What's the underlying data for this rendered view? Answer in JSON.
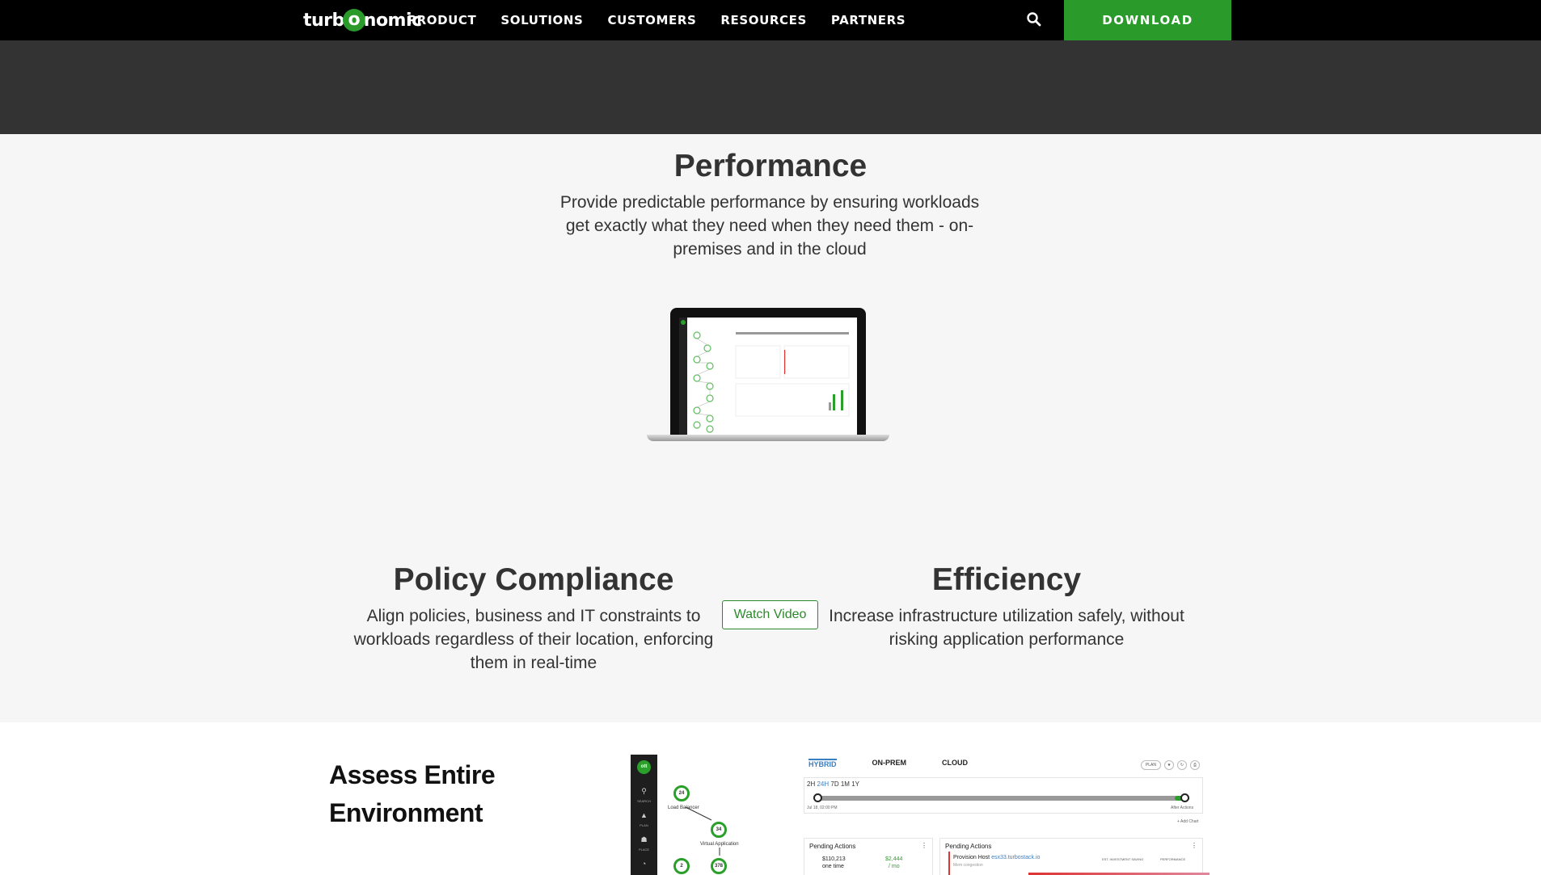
{
  "nav": {
    "logo_left": "turb",
    "logo_o": "o",
    "logo_right": "nomic",
    "links": [
      "PRODUCT",
      "SOLUTIONS",
      "CUSTOMERS",
      "RESOURCES",
      "PARTNERS"
    ],
    "search_icon": "search-icon",
    "download_label": "DOWNLOAD",
    "download_color": "#2a9a2a"
  },
  "features": {
    "performance": {
      "title": "Performance",
      "description": "Provide predictable performance by ensuring workloads get exactly what they need when they need them - on-premises and in the cloud"
    },
    "watch_video_label": "Watch Video",
    "policy": {
      "title": "Policy Compliance",
      "description": "Align policies, business and IT constraints to workloads regardless of their location, enforcing them in real-time"
    },
    "efficiency": {
      "title": "Efficiency",
      "description": "Increase infrastructure utilization safely, without risking application performance"
    }
  },
  "assess": {
    "title": "Assess Entire Environment",
    "dashboard": {
      "logo_text": "ott",
      "sidebar": [
        "SEARCH",
        "PLAN",
        "PLACE"
      ],
      "tabs": [
        "HYBRID",
        "ON-PREM",
        "CLOUD"
      ],
      "active_tab": "HYBRID",
      "toolbar_plan": "PLAN",
      "range_options": [
        "2H",
        "24H",
        "7D",
        "1M",
        "1Y"
      ],
      "range_selected": "24H",
      "slider_start_label": "Jul 18, 02:00 PM",
      "slider_end_label": "After Actions",
      "add_chart": "+ Add Chart",
      "topology": [
        {
          "value": "24",
          "label": "Load Balancer"
        },
        {
          "value": "34",
          "label": "Virtual Application"
        },
        {
          "value": "2",
          "label": ""
        },
        {
          "value": "378",
          "label": ""
        }
      ],
      "pending_left": {
        "title": "Pending Actions",
        "amount": "$110,213",
        "amount_label": "one time",
        "savings": "$2,444",
        "savings_label": "/ mo"
      },
      "pending_right": {
        "title": "Pending Actions",
        "action": "Provision Host",
        "action_target": "esx33.turbostack.io",
        "action_note": "Mem congestion",
        "columns": [
          "EST. INVESTMENT SAVING",
          "PERFORMANCE"
        ]
      }
    }
  }
}
